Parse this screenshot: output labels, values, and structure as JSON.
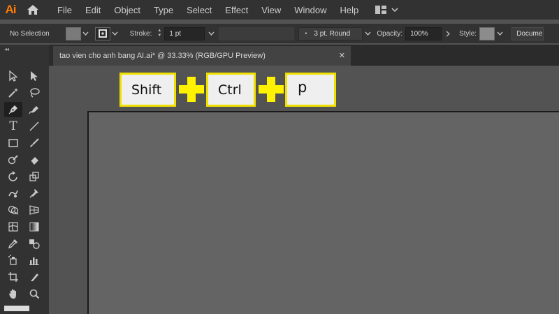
{
  "app": {
    "logo_text": "Ai",
    "accent": "#ff7c00"
  },
  "menu": {
    "items": [
      "File",
      "Edit",
      "Object",
      "Type",
      "Select",
      "Effect",
      "View",
      "Window",
      "Help"
    ]
  },
  "control_bar": {
    "selection_status": "No Selection",
    "fill_color": "#7a7a7a",
    "stroke_label": "Stroke:",
    "stroke_weight": "1 pt",
    "brush_label": "3 pt. Round",
    "opacity_label": "Opacity:",
    "opacity_value": "100%",
    "style_label": "Style:",
    "document_setup_label": "Documen"
  },
  "document": {
    "tab_title": "tao vien cho anh bang AI.ai* @ 33.33% (RGB/GPU Preview)",
    "close_glyph": "✕"
  },
  "shortcut_overlay": {
    "keys": [
      "Shift",
      "Ctrl",
      "p"
    ],
    "key_border_color": "#f0e000",
    "plus_color": "#fff200"
  },
  "tools": [
    "selection-tool",
    "direct-selection-tool",
    "magic-wand-tool",
    "lasso-tool",
    "pen-tool",
    "curvature-tool",
    "type-tool",
    "line-segment-tool",
    "rectangle-tool",
    "paintbrush-tool",
    "shaper-tool",
    "eraser-tool",
    "rotate-tool",
    "scale-tool",
    "warp-tool",
    "puppet-warp-tool",
    "shape-builder-tool",
    "perspective-grid-tool",
    "mesh-tool",
    "gradient-tool",
    "eyedropper-tool",
    "blend-tool",
    "symbol-sprayer-tool",
    "column-graph-tool",
    "artboard-tool",
    "slice-tool",
    "hand-tool",
    "zoom-tool"
  ]
}
